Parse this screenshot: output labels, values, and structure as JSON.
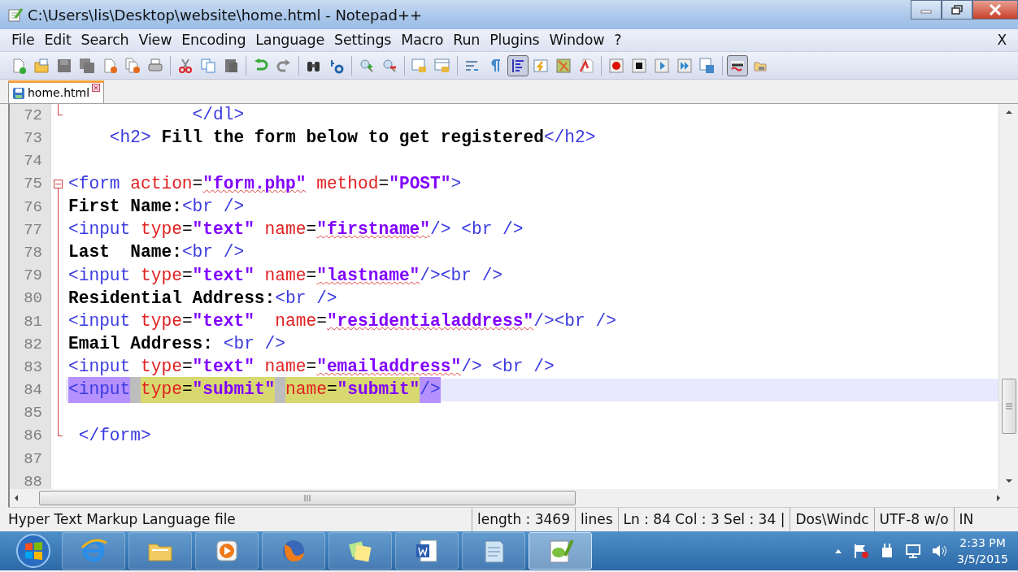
{
  "window": {
    "title": "C:\\Users\\lis\\Desktop\\website\\home.html - Notepad++"
  },
  "menu": {
    "items": [
      "File",
      "Edit",
      "Search",
      "View",
      "Encoding",
      "Language",
      "Settings",
      "Macro",
      "Run",
      "Plugins",
      "Window",
      "?"
    ],
    "close_label": "X"
  },
  "toolbar": [
    {
      "kind": "new",
      "pressed": false
    },
    {
      "kind": "open",
      "pressed": false
    },
    {
      "kind": "save",
      "pressed": false
    },
    {
      "kind": "save-all",
      "pressed": false
    },
    {
      "kind": "close",
      "pressed": false
    },
    {
      "kind": "close-all",
      "pressed": false
    },
    {
      "kind": "print",
      "pressed": false
    },
    {
      "kind": "sep"
    },
    {
      "kind": "cut",
      "pressed": false
    },
    {
      "kind": "copy",
      "pressed": false
    },
    {
      "kind": "paste",
      "pressed": false
    },
    {
      "kind": "sep"
    },
    {
      "kind": "undo",
      "pressed": false
    },
    {
      "kind": "redo",
      "pressed": false
    },
    {
      "kind": "sep"
    },
    {
      "kind": "find",
      "pressed": false
    },
    {
      "kind": "replace",
      "pressed": false
    },
    {
      "kind": "sep"
    },
    {
      "kind": "zoom-in",
      "pressed": false
    },
    {
      "kind": "zoom-out",
      "pressed": false
    },
    {
      "kind": "sep"
    },
    {
      "kind": "sync-v",
      "pressed": false
    },
    {
      "kind": "sync-h",
      "pressed": false
    },
    {
      "kind": "sep"
    },
    {
      "kind": "wrap",
      "pressed": false
    },
    {
      "kind": "pilcrow",
      "pressed": false
    },
    {
      "kind": "indent-guide",
      "pressed": true
    },
    {
      "kind": "lang",
      "pressed": false
    },
    {
      "kind": "map",
      "pressed": false
    },
    {
      "kind": "function",
      "pressed": false
    },
    {
      "kind": "sep"
    },
    {
      "kind": "record",
      "pressed": false
    },
    {
      "kind": "stop",
      "pressed": false
    },
    {
      "kind": "play",
      "pressed": false
    },
    {
      "kind": "play-multi",
      "pressed": false
    },
    {
      "kind": "save-macro",
      "pressed": false
    },
    {
      "kind": "sep"
    },
    {
      "kind": "spellcheck",
      "pressed": true
    },
    {
      "kind": "folder",
      "pressed": false
    }
  ],
  "tabs": [
    {
      "label": "home.html",
      "selected": true
    }
  ],
  "editor": {
    "lines": [
      {
        "number": "72",
        "kind": "close",
        "tokens": [
          {
            "kind": "tag",
            "text": "            </dl>"
          }
        ]
      },
      {
        "number": "73",
        "kind": "plain",
        "tokens": [
          {
            "kind": "tag",
            "text": "    <h2>"
          },
          {
            "kind": "text",
            "text": " Fill the form below to get registered"
          },
          {
            "kind": "tag",
            "text": "</h2>"
          }
        ]
      },
      {
        "number": "74",
        "kind": "plain"
      },
      {
        "number": "75",
        "kind": "open",
        "tokens": [
          {
            "kind": "tag",
            "text": "<form"
          },
          {
            "kind": "attr",
            "text": " action"
          },
          {
            "kind": "plain",
            "text": "="
          },
          {
            "kind": "value",
            "text": "\"form.php\"",
            "misspelled": true
          },
          {
            "kind": "attr",
            "text": " method"
          },
          {
            "kind": "plain",
            "text": "="
          },
          {
            "kind": "value",
            "text": "\"POST\""
          },
          {
            "kind": "tag",
            "text": ">"
          }
        ]
      },
      {
        "number": "76",
        "kind": "body",
        "tokens": [
          {
            "kind": "text",
            "text": "First Name:"
          },
          {
            "kind": "tag",
            "text": "<br />"
          }
        ]
      },
      {
        "number": "77",
        "kind": "body",
        "tokens": [
          {
            "kind": "tag",
            "text": "<input"
          },
          {
            "kind": "attr",
            "text": " type"
          },
          {
            "kind": "plain",
            "text": "="
          },
          {
            "kind": "value",
            "text": "\"text\""
          },
          {
            "kind": "attr",
            "text": " name"
          },
          {
            "kind": "plain",
            "text": "="
          },
          {
            "kind": "value",
            "text": "\"firstname\"",
            "misspelled": true
          },
          {
            "kind": "tag",
            "text": "/> <br />"
          }
        ]
      },
      {
        "number": "78",
        "kind": "body",
        "tokens": [
          {
            "kind": "text",
            "text": "Last  Name:"
          },
          {
            "kind": "tag",
            "text": "<br />"
          }
        ]
      },
      {
        "number": "79",
        "kind": "body",
        "tokens": [
          {
            "kind": "tag",
            "text": "<input"
          },
          {
            "kind": "attr",
            "text": " type"
          },
          {
            "kind": "plain",
            "text": "="
          },
          {
            "kind": "value",
            "text": "\"text\""
          },
          {
            "kind": "attr",
            "text": " name"
          },
          {
            "kind": "plain",
            "text": "="
          },
          {
            "kind": "value",
            "text": "\"lastname\"",
            "misspelled": true
          },
          {
            "kind": "tag",
            "text": "/><br />"
          }
        ]
      },
      {
        "number": "80",
        "kind": "body",
        "tokens": [
          {
            "kind": "text",
            "text": "Residential Address:"
          },
          {
            "kind": "tag",
            "text": "<br />"
          }
        ]
      },
      {
        "number": "81",
        "kind": "body",
        "tokens": [
          {
            "kind": "tag",
            "text": "<input"
          },
          {
            "kind": "attr",
            "text": " type"
          },
          {
            "kind": "plain",
            "text": "="
          },
          {
            "kind": "value",
            "text": "\"text\""
          },
          {
            "kind": "attr",
            "text": "  name"
          },
          {
            "kind": "plain",
            "text": "="
          },
          {
            "kind": "value",
            "text": "\"residentialaddress\"",
            "misspelled": true
          },
          {
            "kind": "tag",
            "text": "/><br />"
          }
        ]
      },
      {
        "number": "82",
        "kind": "body",
        "tokens": [
          {
            "kind": "text",
            "text": "Email Address:"
          },
          {
            "kind": "tag",
            "text": " <br />"
          }
        ]
      },
      {
        "number": "83",
        "kind": "body",
        "tokens": [
          {
            "kind": "tag",
            "text": "<input"
          },
          {
            "kind": "attr",
            "text": " type"
          },
          {
            "kind": "plain",
            "text": "="
          },
          {
            "kind": "value",
            "text": "\"text\""
          },
          {
            "kind": "attr",
            "text": " name"
          },
          {
            "kind": "plain",
            "text": "="
          },
          {
            "kind": "value",
            "text": "\"emailaddress\"",
            "misspelled": true
          },
          {
            "kind": "tag",
            "text": "/> <br />"
          }
        ]
      },
      {
        "number": "84",
        "kind": "body",
        "current": true,
        "tokens": [
          {
            "kind": "tag",
            "text": "<input",
            "tag_match": true
          },
          {
            "kind": "attr",
            "text": "type",
            "highlighted": true,
            "gap_before": true
          },
          {
            "kind": "plain",
            "text": "=",
            "highlighted": true
          },
          {
            "kind": "value",
            "text": "\"submit\"",
            "highlighted": true
          },
          {
            "kind": "attr",
            "text": "name",
            "highlighted": true,
            "gap_before": true
          },
          {
            "kind": "plain",
            "text": "=",
            "highlighted": true
          },
          {
            "kind": "value",
            "text": "\"submit\"",
            "highlighted": true
          },
          {
            "kind": "tag",
            "text": "/>",
            "tag_match": true
          }
        ]
      },
      {
        "number": "85",
        "kind": "body"
      },
      {
        "number": "86",
        "kind": "close",
        "tokens": [
          {
            "kind": "tag",
            "text": " </form>"
          }
        ]
      },
      {
        "number": "87",
        "kind": "plain"
      },
      {
        "number": "88",
        "kind": "plain"
      }
    ]
  },
  "status_bar": [
    "Hyper Text Markup Language file",
    "length : 3469",
    "lines",
    "Ln : 84    Col : 3    Sel : 34 | ",
    "Dos\\Windc",
    "UTF-8 w/o",
    "IN"
  ],
  "taskbar": {
    "items": [
      {
        "kind": "browser",
        "active": false
      },
      {
        "kind": "folder",
        "active": false
      },
      {
        "kind": "media",
        "active": false
      },
      {
        "kind": "fox",
        "active": false
      },
      {
        "kind": "notes",
        "active": false
      },
      {
        "kind": "word",
        "active": false
      },
      {
        "kind": "notepad",
        "active": false
      },
      {
        "kind": "npp",
        "active": true
      }
    ],
    "time": "2:33 PM",
    "date": "3/5/2015"
  }
}
